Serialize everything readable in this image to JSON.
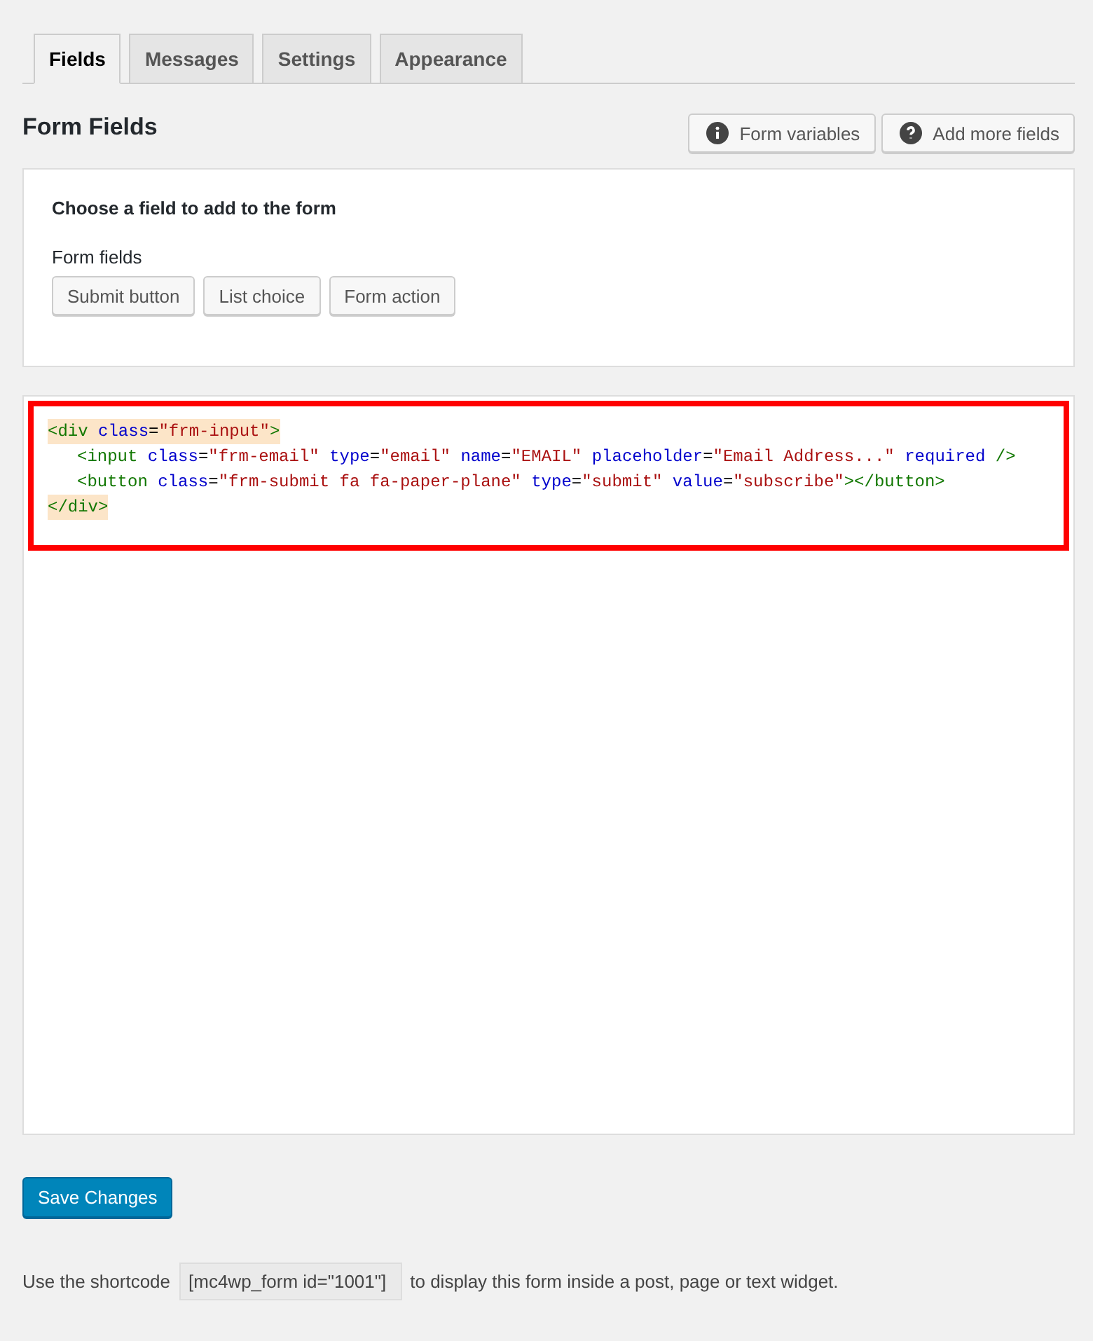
{
  "tabs": [
    {
      "label": "Fields",
      "selected": true
    },
    {
      "label": "Messages",
      "selected": false
    },
    {
      "label": "Settings",
      "selected": false
    },
    {
      "label": "Appearance",
      "selected": false
    }
  ],
  "heading": "Form Fields",
  "header_buttons": [
    {
      "label": "Form variables",
      "kind": "info"
    },
    {
      "label": "Add more fields",
      "kind": "help"
    }
  ],
  "field_chooser": {
    "title": "Choose a field to add to the form",
    "group_label": "Form fields",
    "buttons": [
      "Submit button",
      "List choice",
      "Form action"
    ]
  },
  "code": {
    "highlighted": true,
    "lines": [
      {
        "matched": true,
        "tokens": [
          {
            "kind": "tag",
            "text": "<div"
          },
          {
            "kind": "attr",
            "text": " class"
          },
          {
            "kind": "plain",
            "text": "="
          },
          {
            "kind": "string",
            "text": "\"frm-input\""
          },
          {
            "kind": "tag",
            "text": ">"
          }
        ],
        "children": [
          {
            "matched": false,
            "tokens": [
              {
                "kind": "tag",
                "text": "<input"
              },
              {
                "kind": "attr",
                "text": " class"
              },
              {
                "kind": "plain",
                "text": "="
              },
              {
                "kind": "string",
                "text": "\"frm-email\""
              },
              {
                "kind": "attr",
                "text": " type"
              },
              {
                "kind": "plain",
                "text": "="
              },
              {
                "kind": "string",
                "text": "\"email\""
              },
              {
                "kind": "attr",
                "text": " name"
              },
              {
                "kind": "plain",
                "text": "="
              },
              {
                "kind": "string",
                "text": "\"EMAIL\""
              },
              {
                "kind": "attr",
                "text": " placeholder"
              },
              {
                "kind": "plain",
                "text": "="
              },
              {
                "kind": "string",
                "text": "\"Email Address...\""
              },
              {
                "kind": "attr",
                "text": " required"
              },
              {
                "kind": "tag",
                "text": " />"
              }
            ]
          },
          {
            "matched": false,
            "tokens": [
              {
                "kind": "tag",
                "text": "<button"
              },
              {
                "kind": "attr",
                "text": " class"
              },
              {
                "kind": "plain",
                "text": "="
              },
              {
                "kind": "string",
                "text": "\"frm-submit fa fa-paper-plane\""
              },
              {
                "kind": "attr",
                "text": " type"
              },
              {
                "kind": "plain",
                "text": "="
              },
              {
                "kind": "string",
                "text": "\"submit\""
              },
              {
                "kind": "attr",
                "text": " value"
              },
              {
                "kind": "plain",
                "text": "="
              },
              {
                "kind": "string",
                "text": "\"subscribe\""
              },
              {
                "kind": "tag",
                "text": "></button>"
              }
            ]
          }
        ]
      },
      {
        "matched": true,
        "tokens": [
          {
            "kind": "tag",
            "text": "</div>"
          }
        ]
      }
    ]
  },
  "save_button": "Save Changes",
  "shortcode": {
    "before": "Use the shortcode",
    "value": "[mc4wp_form id=\"1001\"]",
    "after": "to display this form inside a post, page or text widget."
  }
}
